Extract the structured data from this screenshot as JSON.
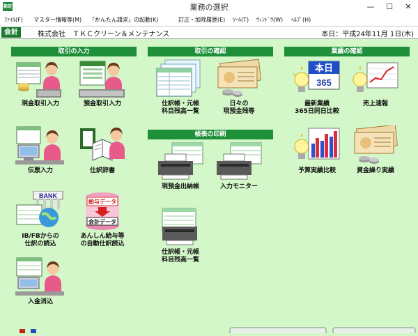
{
  "window": {
    "title": "業務の選択",
    "app_icon_text": "勘定"
  },
  "menu": [
    "ﾌｧｲﾙ(F)",
    "マスター情報等(M)",
    "「かんたん請求」の起動(K)",
    "訂正・加除履歴(E)",
    "ﾂｰﾙ(T)",
    "ｳｨﾝﾄﾞｳ(W)",
    "ﾍﾙﾌﾟ(H)"
  ],
  "info": {
    "module": "会計",
    "company": "株式会社　ＴＫＣクリーン＆メンテナンス",
    "today": "本日：平成24年11月 1日(木)"
  },
  "sections": {
    "torihiki_input": "取引の入力",
    "torihiki_confirm": "取引の確認",
    "chohyo_print": "帳表の印刷",
    "gyoseki_confirm": "業績の確認"
  },
  "tiles": {
    "genkin": [
      "現金取引入力"
    ],
    "yokin": [
      "預金取引入力"
    ],
    "denpyo": [
      "伝票入力"
    ],
    "jisho": [
      "仕訳辞書"
    ],
    "ibfb": [
      "IB/FBからの",
      "仕訳の読込"
    ],
    "kyuyo": [
      "あんしん給与等",
      "の自動仕訳読込"
    ],
    "nyukin": [
      "入金消込"
    ],
    "shiwake_list": [
      "仕訳帳・元帳",
      "科目残高一覧"
    ],
    "nichinichi": [
      "日々の",
      "現預金残等"
    ],
    "suitouchou": [
      "現預金出納帳"
    ],
    "monitor": [
      "入力モニター"
    ],
    "shiwake_print": [
      "仕訳帳・元帳",
      "科目残高一覧"
    ],
    "saishin": [
      "最新業績",
      "365日同日比較"
    ],
    "uriage": [
      "売上速報"
    ],
    "yosan": [
      "予算実績比較"
    ],
    "shikin": [
      "資金繰り実績"
    ]
  },
  "icon_texts": {
    "bank": "BANK",
    "kyuyo_data": "給与データ",
    "kaikei_data": "会計データ",
    "honjitsu": "本日",
    "days365": "365"
  }
}
